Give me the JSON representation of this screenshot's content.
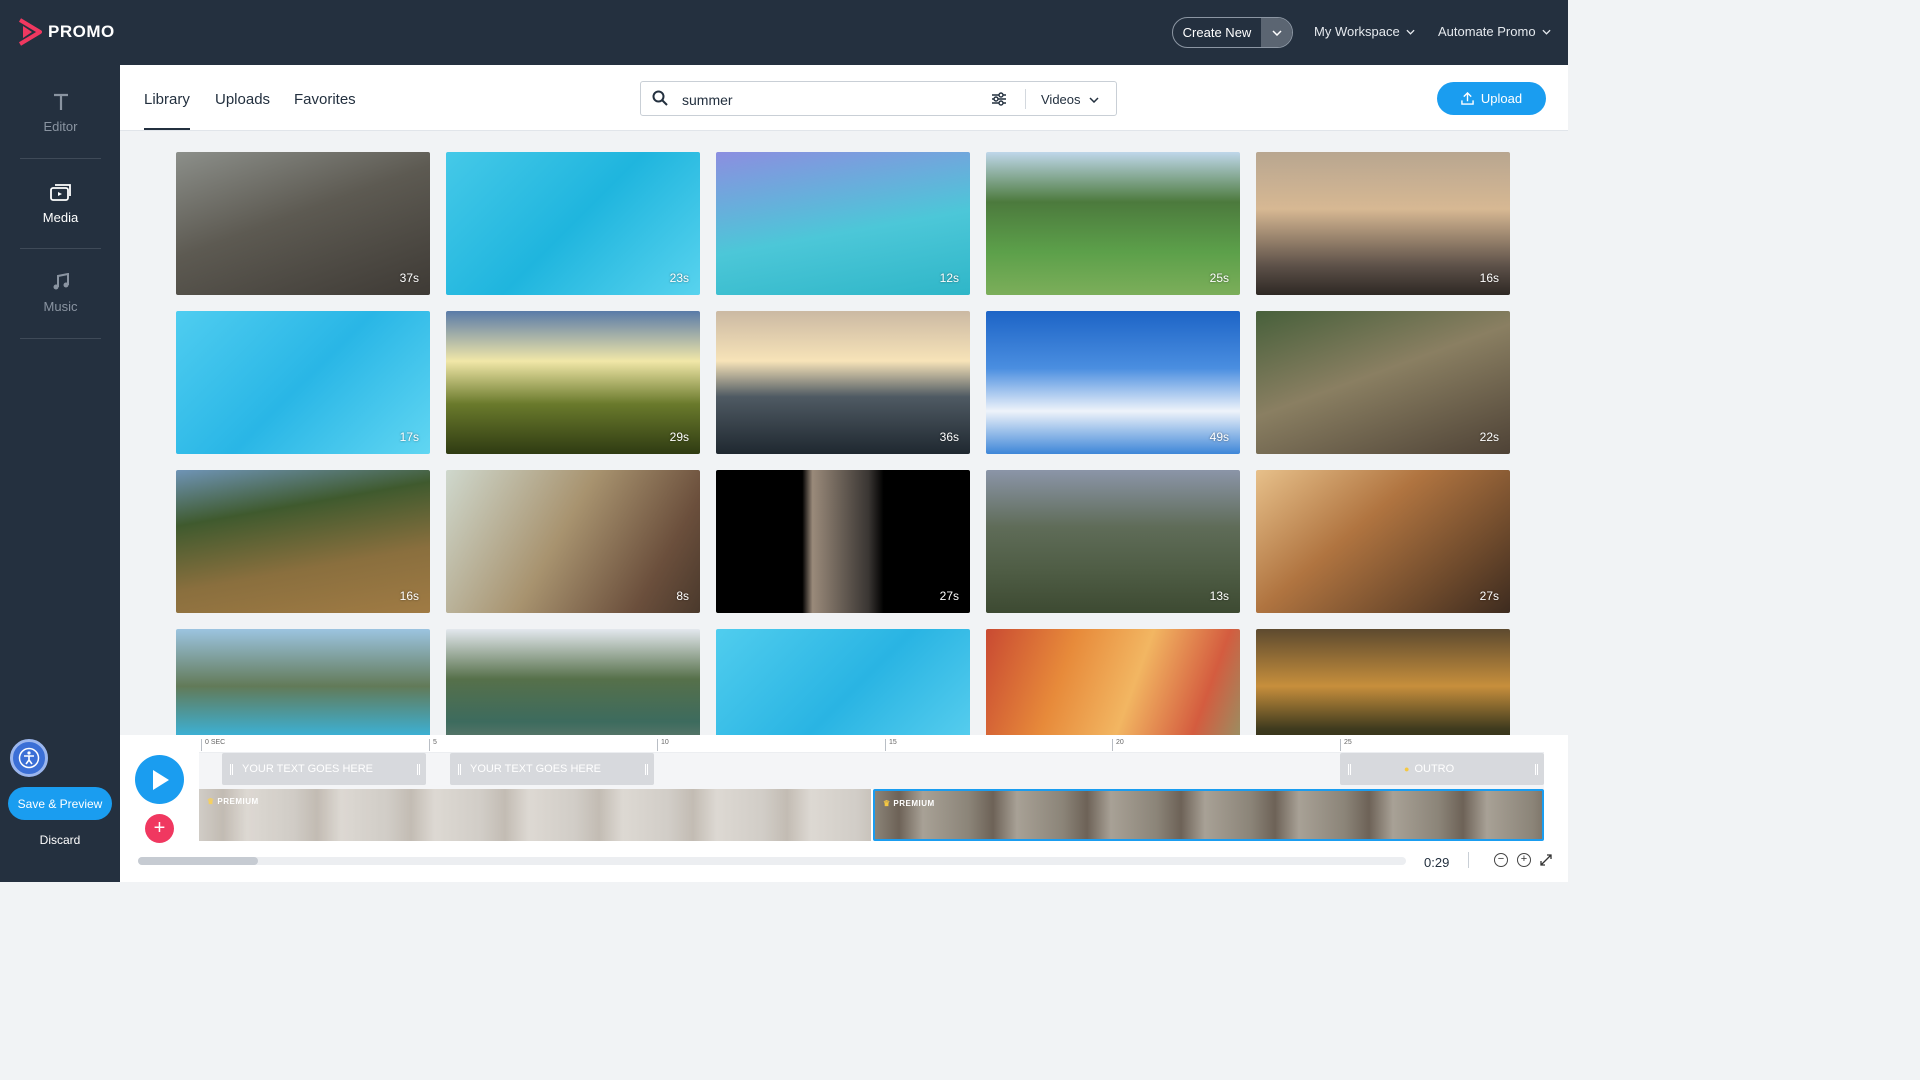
{
  "app": {
    "name": "PROMO"
  },
  "topbar": {
    "create_new": "Create New",
    "workspace": "My Workspace",
    "automate": "Automate Promo"
  },
  "sidebar": {
    "items": [
      {
        "label": "Editor",
        "icon": "text-icon"
      },
      {
        "label": "Media",
        "icon": "media-icon",
        "active": true
      },
      {
        "label": "Music",
        "icon": "music-icon"
      }
    ],
    "save_preview": "Save & Preview",
    "discard": "Discard"
  },
  "tabs": [
    "Library",
    "Uploads",
    "Favorites"
  ],
  "search": {
    "query": "summer",
    "type": "Videos"
  },
  "upload_label": "Upload",
  "media": [
    {
      "duration": "37s",
      "scene": "festival crowd"
    },
    {
      "duration": "23s",
      "scene": "kids swimming in pool"
    },
    {
      "duration": "12s",
      "scene": "paddle board feet"
    },
    {
      "duration": "25s",
      "scene": "father and son by backyard pool"
    },
    {
      "duration": "16s",
      "scene": "couple on boat at sunset"
    },
    {
      "duration": "17s",
      "scene": "pool water surface"
    },
    {
      "duration": "29s",
      "scene": "running in sunny meadow"
    },
    {
      "duration": "36s",
      "scene": "sunset over water"
    },
    {
      "duration": "49s",
      "scene": "blue sky with clouds"
    },
    {
      "duration": "22s",
      "scene": "couple on porch steps"
    },
    {
      "duration": "16s",
      "scene": "hill trail with forest"
    },
    {
      "duration": "8s",
      "scene": "fan and woman on couch"
    },
    {
      "duration": "27s",
      "scene": "concert hand raised"
    },
    {
      "duration": "13s",
      "scene": "house with dogs"
    },
    {
      "duration": "27s",
      "scene": "dancing at festival sunset"
    },
    {
      "duration": "",
      "scene": "pool party"
    },
    {
      "duration": "",
      "scene": "kayaks on mountain lake"
    },
    {
      "duration": "",
      "scene": "pool water"
    },
    {
      "duration": "",
      "scene": "colorful coastal houses"
    },
    {
      "duration": "",
      "scene": "sunset over river"
    }
  ],
  "timeline": {
    "ruler": [
      "0 SEC",
      "5",
      "10",
      "15",
      "20",
      "25"
    ],
    "text_clips": [
      "YOUR TEXT GOES HERE",
      "YOUR TEXT GOES HERE"
    ],
    "outro": "OUTRO",
    "premium": "PREMIUM",
    "time": "0:29"
  },
  "colors": {
    "sidebar": "#24303f",
    "accent": "#1a9df0",
    "add": "#f03860"
  }
}
